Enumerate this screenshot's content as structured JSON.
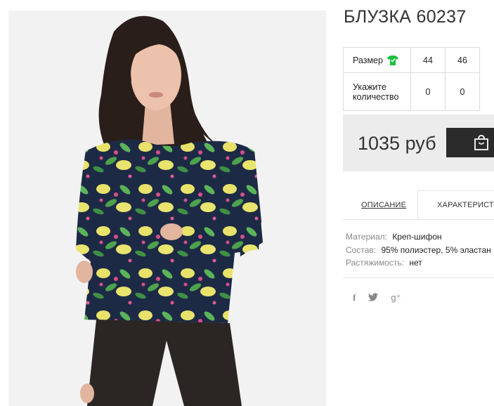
{
  "product": {
    "title": "БЛУЗКА 60237",
    "image_alt": "Blouse with lemon print"
  },
  "sizes_table": {
    "size_label": "Размер",
    "quantity_label": "Укажите количество",
    "sizes": [
      "44",
      "46"
    ],
    "quantities": [
      "0",
      "0"
    ],
    "size_icon": "tshirt-icon",
    "size_icon_color": "#18c03b"
  },
  "price": {
    "text": "1035 руб",
    "cart_icon": "shopping-bag-icon",
    "button_color": "#2b2b2b"
  },
  "tabs": [
    {
      "label": "ОПИСАНИЕ",
      "active": false
    },
    {
      "label": "ХАРАКТЕРИСТИ",
      "active": true
    }
  ],
  "specs": [
    {
      "key": "Материал:",
      "value": "Креп-шифон"
    },
    {
      "key": "Состав:",
      "value": "95% полиэстер, 5% эластан"
    },
    {
      "key": "Растяжимость:",
      "value": "нет"
    }
  ],
  "social": [
    {
      "icon": "facebook-icon",
      "glyph": "f"
    },
    {
      "icon": "twitter-icon",
      "glyph": "🐦"
    },
    {
      "icon": "google-plus-icon",
      "glyph": "g⁺"
    }
  ]
}
